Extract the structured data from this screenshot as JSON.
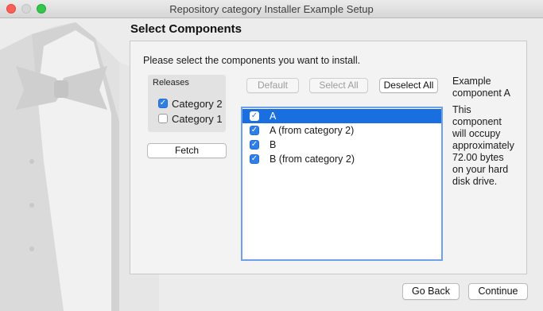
{
  "window": {
    "title": "Repository category Installer Example Setup"
  },
  "page": {
    "heading": "Select Components",
    "instruction": "Please select the components you want to install."
  },
  "releases": {
    "label": "Releases",
    "items": [
      {
        "label": "Category 2",
        "checked": true
      },
      {
        "label": "Category 1",
        "checked": false
      }
    ],
    "fetch_label": "Fetch"
  },
  "toolbar": {
    "default_label": "Default",
    "select_all_label": "Select All",
    "deselect_all_label": "Deselect All"
  },
  "components": [
    {
      "label": "A",
      "checked": true,
      "selected": true
    },
    {
      "label": "A (from category 2)",
      "checked": true,
      "selected": false
    },
    {
      "label": "B",
      "checked": true,
      "selected": false
    },
    {
      "label": "B (from category 2)",
      "checked": true,
      "selected": false
    }
  ],
  "description": {
    "title_line1": "Example",
    "title_line2": "component A",
    "body_lines": [
      "This",
      "component",
      "will occupy",
      "approximately",
      "72.00 bytes",
      "on your hard",
      "disk drive."
    ]
  },
  "footer": {
    "back_label": "Go Back",
    "continue_label": "Continue"
  },
  "colors": {
    "accent": "#1a6fe0",
    "close": "#fc5f57",
    "zoom": "#34c84a"
  },
  "icons": {
    "check": "✓"
  }
}
